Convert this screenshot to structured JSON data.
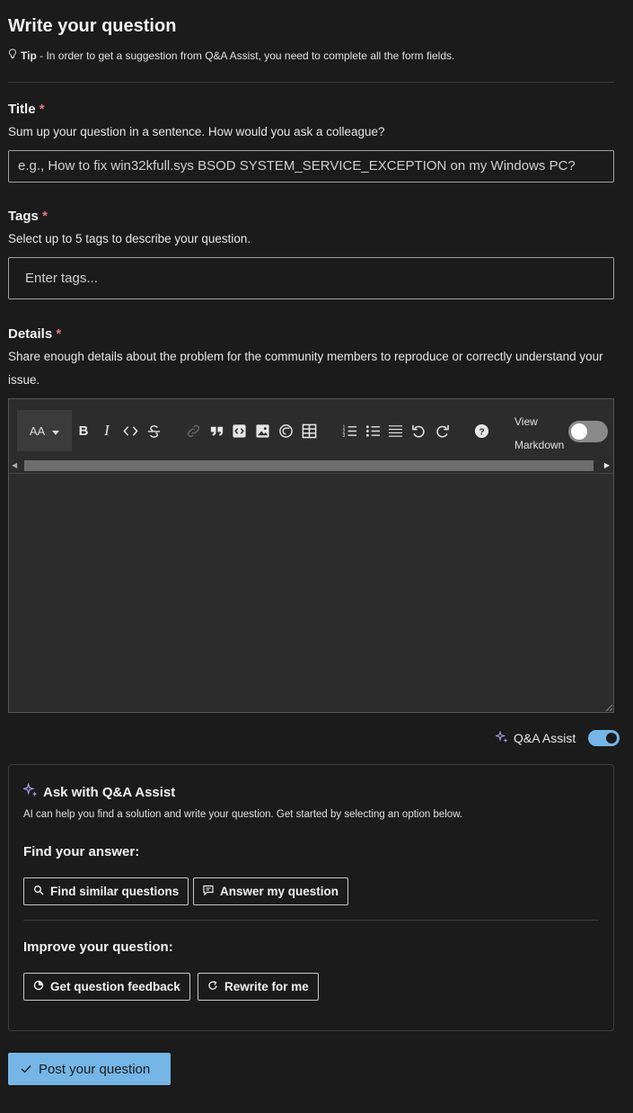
{
  "page": {
    "title": "Write your question",
    "tip_label": "Tip",
    "tip_text": " - In order to get a suggestion from Q&A Assist, you need to complete all the form fields."
  },
  "title_field": {
    "label": "Title",
    "required_mark": "*",
    "help": "Sum up your question in a sentence. How would you ask a colleague?",
    "placeholder": "e.g., How to fix win32kfull.sys BSOD SYSTEM_SERVICE_EXCEPTION on my Windows PC?",
    "value": ""
  },
  "tags_field": {
    "label": "Tags",
    "required_mark": "*",
    "help": "Select up to 5 tags to describe your question.",
    "placeholder": "Enter tags...",
    "value": ""
  },
  "details_field": {
    "label": "Details",
    "required_mark": "*",
    "help": "Share enough details about the problem for the community members to reproduce or correctly understand your issue."
  },
  "editor": {
    "font_size_label": "AA",
    "view_markdown_label_1": "View",
    "view_markdown_label_2": "Markdown",
    "view_markdown_on": false,
    "toolbar_icons": [
      "font-size-icon",
      "bold-icon",
      "italic-icon",
      "code-icon",
      "strikethrough-icon",
      "link-icon",
      "quote-icon",
      "code-block-icon",
      "image-icon",
      "attachment-icon",
      "table-icon",
      "numbered-list-icon",
      "bulleted-list-icon",
      "horizontal-rule-icon",
      "undo-icon",
      "redo-icon",
      "help-icon"
    ],
    "content": ""
  },
  "qa_assist_toggle": {
    "label": "Q&A Assist",
    "on": true
  },
  "assist_card": {
    "title": "Ask with Q&A Assist",
    "description": "AI can help you find a solution and write your question. Get started by selecting an option below.",
    "find_heading": "Find your answer:",
    "find_similar_label": "Find similar questions",
    "answer_label": "Answer my question",
    "improve_heading": "Improve your question:",
    "feedback_label": "Get question feedback",
    "rewrite_label": "Rewrite for me"
  },
  "post_button": {
    "label": "Post your question"
  },
  "colors": {
    "accent": "#75b6e7",
    "required": "#e7797d",
    "background": "#1b1b1b",
    "editor_bg": "#2c2c2c"
  }
}
